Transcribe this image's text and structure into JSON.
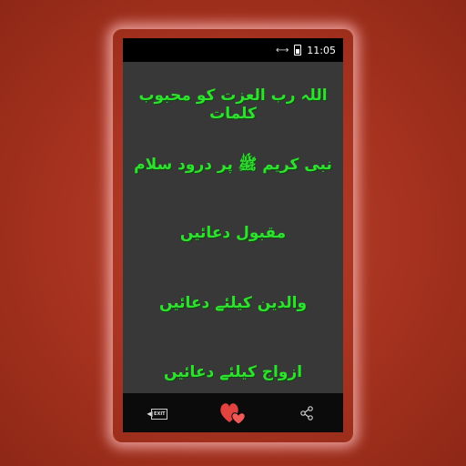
{
  "status_bar": {
    "time": "11:05",
    "signal_icon": "data-arrows-icon",
    "battery_icon": "battery-icon"
  },
  "menu": {
    "items": [
      {
        "label": "اللہ رب العزت کو محبوب کلمات"
      },
      {
        "label": "نبی کریم ﷺ پر درود سلام"
      },
      {
        "label": "مقبول دعائیں"
      },
      {
        "label": "والدین کیلئے دعائیں"
      },
      {
        "label": "ازواج کیلئے دعائیں"
      }
    ]
  },
  "bottom_bar": {
    "exit_label": "EXIT",
    "icons": [
      "exit-icon",
      "favorite-hearts-icon",
      "share-icon"
    ]
  },
  "colors": {
    "background": "#a5321f",
    "content": "#383838",
    "text": "#2fe12f",
    "heart": "#e2433f"
  }
}
